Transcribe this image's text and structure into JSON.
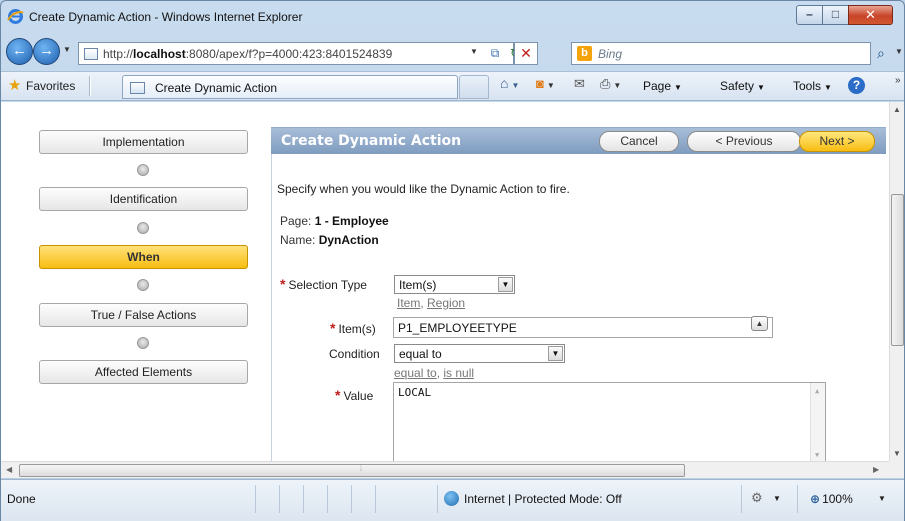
{
  "window": {
    "title": "Create Dynamic Action - Windows Internet Explorer",
    "minimize": "–",
    "maximize": "□",
    "close": "✕"
  },
  "address_bar": {
    "url_prefix": "http://",
    "url_host": "localhost",
    "url_rest": ":8080/apex/f?p=4000:423:8401524839",
    "search_placeholder": "Bing",
    "search_logo": "b"
  },
  "command_bar": {
    "favorites": "Favorites",
    "tab_title": "Create Dynamic Action",
    "page": "Page",
    "safety": "Safety",
    "tools": "Tools",
    "help": "?"
  },
  "wizard": {
    "steps": [
      {
        "label": "Implementation",
        "active": false
      },
      {
        "label": "Identification",
        "active": false
      },
      {
        "label": "When",
        "active": true
      },
      {
        "label": "True / False Actions",
        "active": false
      },
      {
        "label": "Affected Elements",
        "active": false
      }
    ]
  },
  "region": {
    "title": "Create Dynamic Action",
    "cancel": "Cancel",
    "previous": "< Previous",
    "next": "Next >",
    "instruction": "Specify when you would like the Dynamic Action to fire.",
    "page_label": "Page:",
    "page_value": "1 - Employee",
    "name_label": "Name:",
    "name_value": "DynAction"
  },
  "form": {
    "selection_type_label": "Selection Type",
    "selection_type_value": "Item(s)",
    "selection_type_links": [
      "Item",
      "Region"
    ],
    "items_label": "Item(s)",
    "items_value": "P1_EMPLOYEETYPE",
    "condition_label": "Condition",
    "condition_value": "equal to",
    "condition_links": [
      "equal to",
      "is null"
    ],
    "value_label": "Value",
    "value_value": "LOCAL"
  },
  "status_bar": {
    "status": "Done",
    "zone": "Internet | Protected Mode: Off",
    "zoom": "100%"
  },
  "colors": {
    "region_header": "#8aa5c7",
    "active_step": "#f8bd12",
    "required": "#c01e1e"
  },
  "icons": [
    "ie-logo-icon",
    "back-arrow-icon",
    "forward-arrow-icon",
    "page-icon",
    "refresh-icon",
    "stop-icon",
    "search-icon",
    "favorites-star-icon",
    "home-icon",
    "feeds-icon",
    "mail-icon",
    "print-icon",
    "help-icon",
    "popup-lov-icon",
    "globe-icon",
    "security-icon",
    "zoom-icon"
  ]
}
